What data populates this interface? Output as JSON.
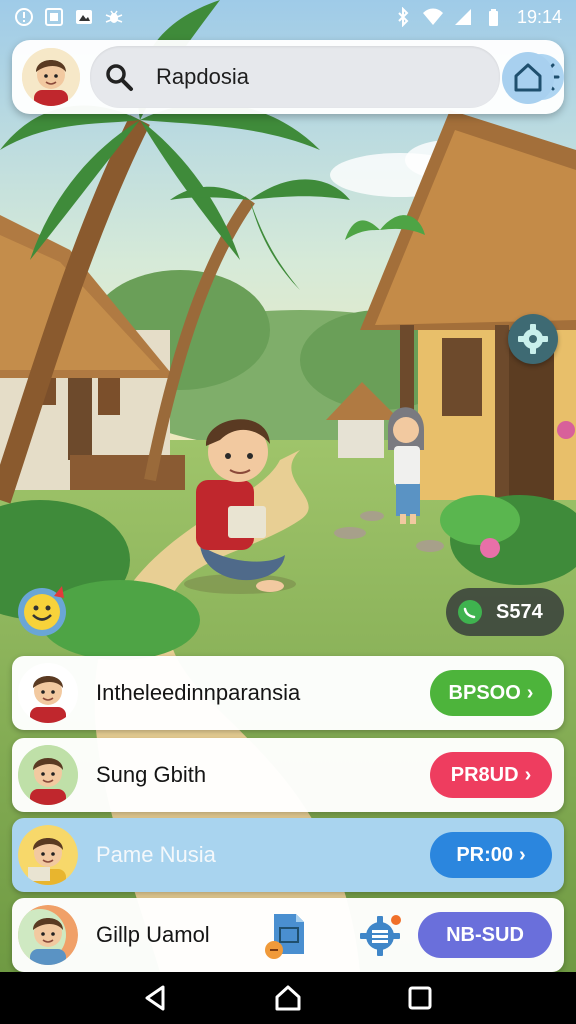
{
  "status_bar": {
    "time": "19:14",
    "left_icons": [
      "alert-icon",
      "photo-icon",
      "gallery-icon",
      "bug-icon"
    ],
    "right_icons": [
      "bluetooth-icon",
      "wifi-icon",
      "signal-icon",
      "battery-icon"
    ]
  },
  "search": {
    "query": "Rapdosia"
  },
  "coins": {
    "amount": "S574"
  },
  "list": [
    {
      "name": "Intheleedinnparansia",
      "action": "BPSOO",
      "color": "#4db43b"
    },
    {
      "name": "Sung Gbith",
      "action": "PR8UD",
      "color": "#ee3d5f"
    },
    {
      "name": "Pame Nusia",
      "action": "PR:00",
      "color": "#2b86de"
    },
    {
      "name": "Gillp Uamol",
      "action": "NB-SUD",
      "color": "#6a6fdb"
    }
  ],
  "nav": {
    "icons": [
      "back-icon",
      "home-icon",
      "recents-icon"
    ]
  },
  "colors": {
    "accent_blue": "#a9d4ef",
    "green": "#4db43b",
    "red": "#ee3d5f",
    "blue": "#2b86de",
    "purple": "#6a6fdb"
  }
}
